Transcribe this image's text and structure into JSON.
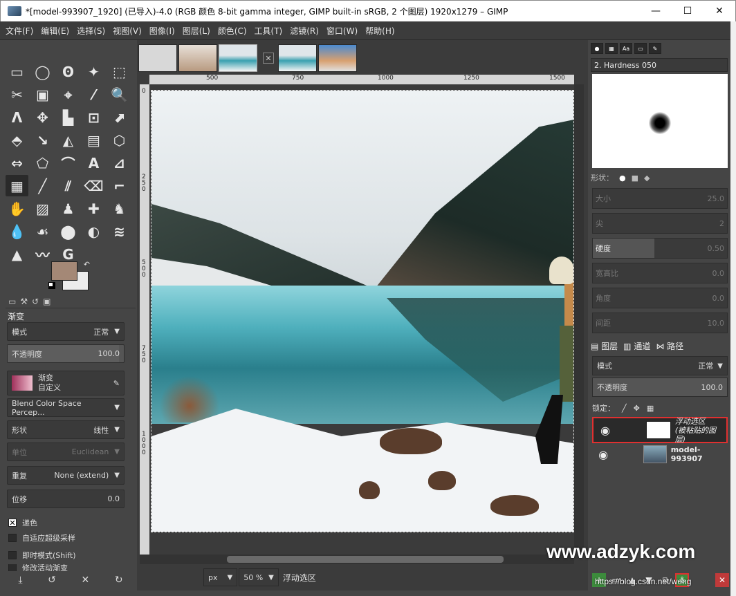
{
  "window": {
    "title": "*[model-993907_1920] (已导入)-4.0 (RGB 颜色 8-bit gamma integer, GIMP built-in sRGB, 2 个图层) 1920x1279 – GIMP",
    "minimize": "—",
    "maximize": "☐",
    "close": "✕"
  },
  "menu": [
    "文件(F)",
    "编辑(E)",
    "选择(S)",
    "视图(V)",
    "图像(I)",
    "图层(L)",
    "颜色(C)",
    "工具(T)",
    "滤镜(R)",
    "窗口(W)",
    "帮助(H)"
  ],
  "tools": [
    "▭",
    "◯",
    "ʘ",
    "✦",
    "⬚",
    "✂",
    "▣",
    "⌖",
    "⁄",
    "🔍",
    "Ʌ",
    "✥",
    "▙",
    "⊡",
    "⬈",
    "⬘",
    "↘",
    "◭",
    "▤",
    "⬡",
    "⇔",
    "⬠",
    "⌒",
    "A",
    "⊿",
    "▦",
    "╱",
    "⫽",
    "⌫",
    "⌐",
    "✋",
    "▨",
    "♟",
    "✚",
    "♞",
    "💧",
    "☙",
    "⬤",
    "◐",
    "≋",
    "▲",
    "〰",
    "G"
  ],
  "fg_color": "#a48876",
  "bg_color": "#ececec",
  "tool_options": {
    "tabs": [
      "▭",
      "⚒",
      "↺",
      "▣"
    ],
    "title": "渐变",
    "mode_label": "模式",
    "mode_value": "正常",
    "opacity_label": "不透明度",
    "opacity_value": "100.0",
    "gradient_label": "渐变",
    "gradient_value": "自定义",
    "blend_space": "Blend Color Space Percep...",
    "shape_label": "形状",
    "shape_value": "线性",
    "metric_label": "单位",
    "metric_value": "Euclidean",
    "repeat_label": "重复",
    "repeat_value": "None (extend)",
    "offset_label": "位移",
    "offset_value": "0.0",
    "dither_label": "递色",
    "adaptive_label": "自适应超级采样",
    "instant_label": "即时模式(Shift)",
    "modify_label": "修改活动渐变"
  },
  "ruler": {
    "top": [
      "500",
      "750",
      "1000",
      "1250",
      "1500"
    ],
    "left": [
      "0",
      "250",
      "500",
      "750",
      "1000"
    ]
  },
  "status": {
    "unit": "px",
    "zoom": "50 %",
    "message": "浮动选区"
  },
  "brushes": {
    "name": "2. Hardness 050",
    "shape_label": "形状：",
    "hardness_label": "硬度",
    "rows": [
      {
        "label": "大小",
        "value": "25.0"
      },
      {
        "label": "尖",
        "value": "2"
      },
      {
        "label": "硬度",
        "value": "0.50"
      },
      {
        "label": "宽高比",
        "value": "0.0"
      },
      {
        "label": "角度",
        "value": "0.0"
      },
      {
        "label": "间距",
        "value": "10.0"
      }
    ]
  },
  "layers": {
    "tabs": [
      "图层",
      "通道",
      "路径"
    ],
    "mode_label": "模式",
    "mode_value": "正常",
    "opacity_label": "不透明度",
    "opacity_value": "100.0",
    "lock_label": "锁定：",
    "items": [
      {
        "name_line1": "浮动选区",
        "name_line2": "(被粘贴的图层)"
      },
      {
        "name_line1": "model-993907",
        "name_line2": ""
      }
    ]
  },
  "watermark": "www.adzyk.com",
  "watermark_small": "https://blog.csdn.net/weng"
}
